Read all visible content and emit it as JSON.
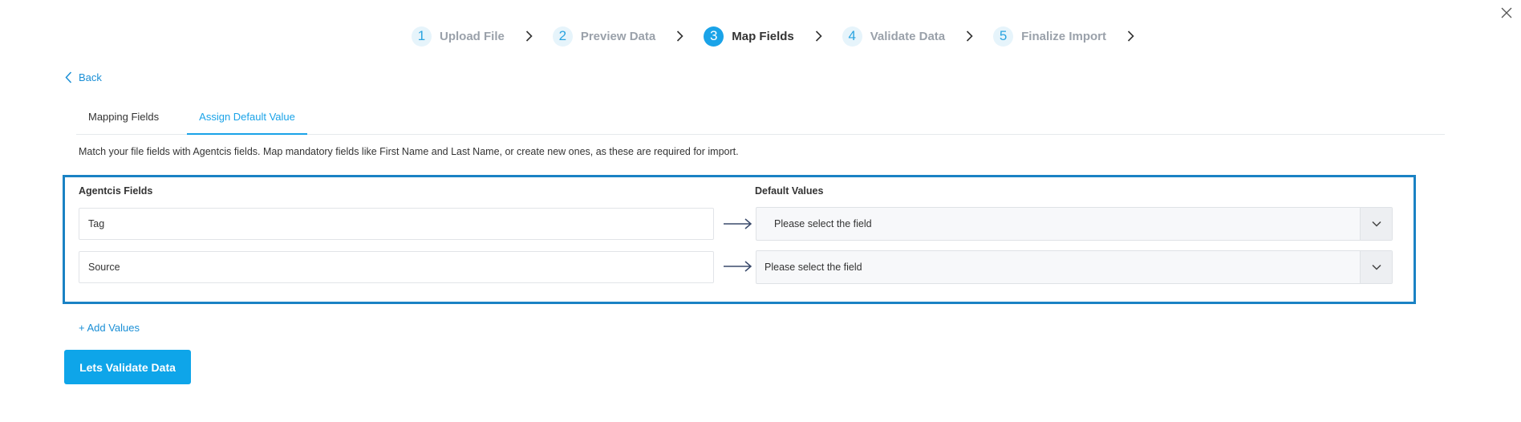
{
  "stepper": {
    "steps": [
      {
        "number": "1",
        "label": "Upload File",
        "active": false
      },
      {
        "number": "2",
        "label": "Preview Data",
        "active": false
      },
      {
        "number": "3",
        "label": "Map Fields",
        "active": true
      },
      {
        "number": "4",
        "label": "Validate Data",
        "active": false
      },
      {
        "number": "5",
        "label": "Finalize Import",
        "active": false
      }
    ]
  },
  "nav": {
    "back_label": "Back",
    "close_icon": "close-icon"
  },
  "tabs": [
    {
      "label": "Mapping Fields",
      "active": false
    },
    {
      "label": "Assign Default Value",
      "active": true
    }
  ],
  "description": "Match your file fields with Agentcis fields. Map mandatory fields like First Name and Last Name, or create new ones, as these are required for import.",
  "mapping": {
    "left_header": "Agentcis Fields",
    "right_header": "Default Values",
    "rows": [
      {
        "field": "Tag",
        "placeholder": "Please select the field"
      },
      {
        "field": "Source",
        "placeholder": "Please select the field"
      }
    ]
  },
  "add_values_label": "+ Add Values",
  "validate_button_label": "Lets Validate Data",
  "colors": {
    "accent": "#1aa3e8",
    "box_border": "#1a82c4",
    "button": "#0ea5e9"
  }
}
